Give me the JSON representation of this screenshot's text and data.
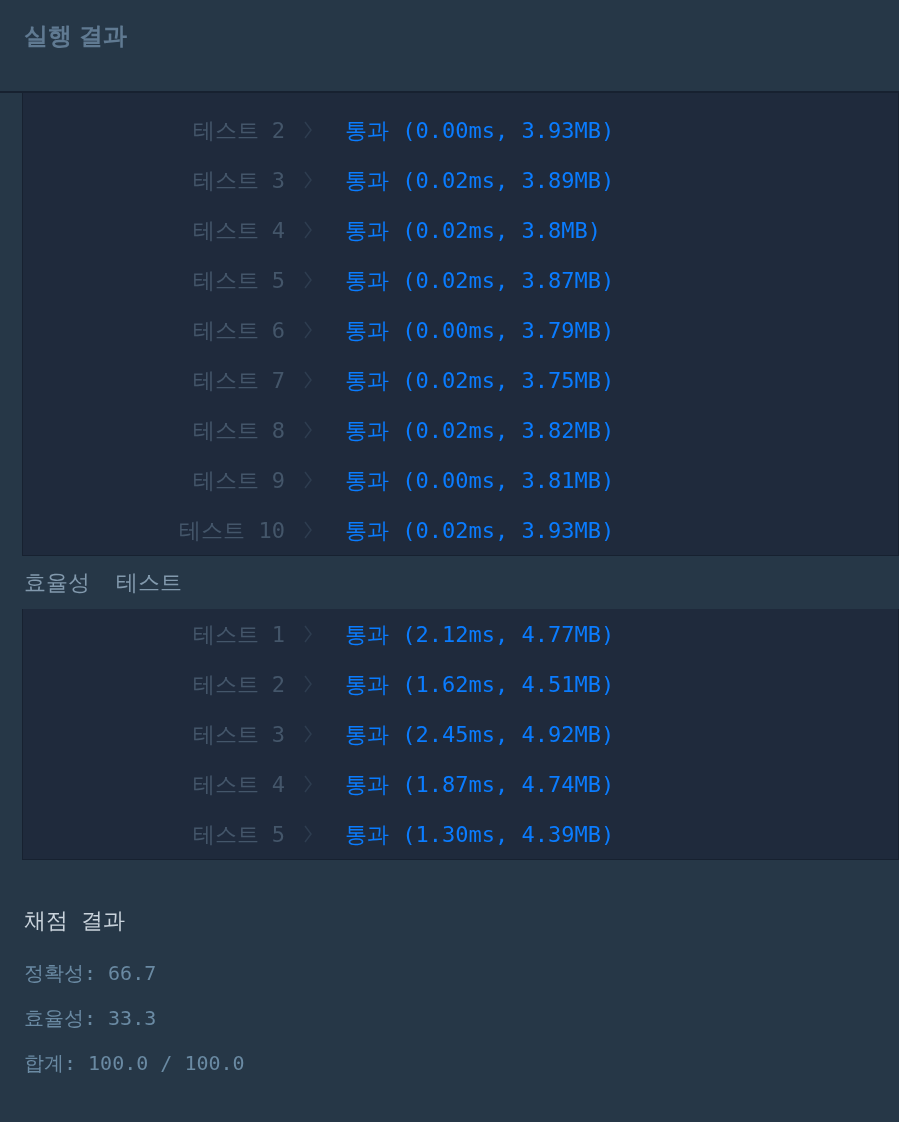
{
  "header": {
    "title": "실행 결과"
  },
  "sections": [
    {
      "rows": [
        {
          "label": "테스트 2",
          "result": "통과 (0.00ms, 3.93MB)"
        },
        {
          "label": "테스트 3",
          "result": "통과 (0.02ms, 3.89MB)"
        },
        {
          "label": "테스트 4",
          "result": "통과 (0.02ms, 3.8MB)"
        },
        {
          "label": "테스트 5",
          "result": "통과 (0.02ms, 3.87MB)"
        },
        {
          "label": "테스트 6",
          "result": "통과 (0.00ms, 3.79MB)"
        },
        {
          "label": "테스트 7",
          "result": "통과 (0.02ms, 3.75MB)"
        },
        {
          "label": "테스트 8",
          "result": "통과 (0.02ms, 3.82MB)"
        },
        {
          "label": "테스트 9",
          "result": "통과 (0.00ms, 3.81MB)"
        },
        {
          "label": "테스트 10",
          "result": "통과 (0.02ms, 3.93MB)"
        }
      ]
    },
    {
      "title": "효율성  테스트",
      "rows": [
        {
          "label": "테스트 1",
          "result": "통과 (2.12ms, 4.77MB)"
        },
        {
          "label": "테스트 2",
          "result": "통과 (1.62ms, 4.51MB)"
        },
        {
          "label": "테스트 3",
          "result": "통과 (2.45ms, 4.92MB)"
        },
        {
          "label": "테스트 4",
          "result": "통과 (1.87ms, 4.74MB)"
        },
        {
          "label": "테스트 5",
          "result": "통과 (1.30ms, 4.39MB)"
        }
      ]
    }
  ],
  "summary": {
    "title": "채점 결과",
    "lines": [
      "정확성: 66.7",
      "효율성: 33.3",
      "합계: 100.0 / 100.0"
    ]
  }
}
